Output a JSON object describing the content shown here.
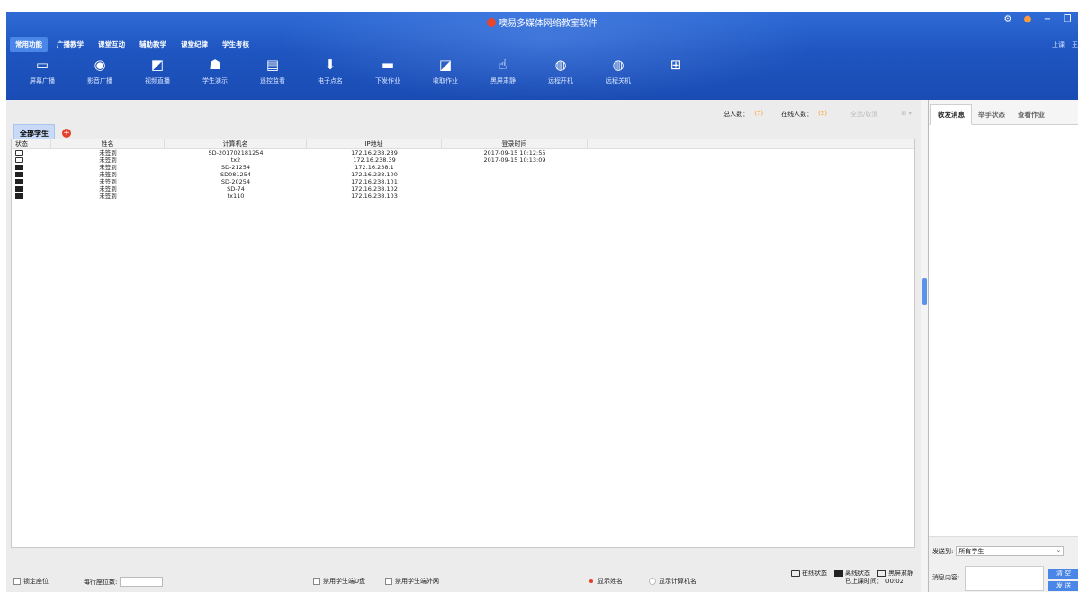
{
  "app": {
    "title": "噢易多媒体网络教室软件",
    "user_labels": [
      "上课",
      "王"
    ]
  },
  "window_controls": {
    "settings": "⚙",
    "alert": "●",
    "minimize": "−",
    "restore": "❐"
  },
  "tabs": [
    {
      "label": "常用功能",
      "active": true
    },
    {
      "label": "广播教学",
      "active": false
    },
    {
      "label": "课堂互动",
      "active": false
    },
    {
      "label": "辅助教学",
      "active": false
    },
    {
      "label": "课堂纪律",
      "active": false
    },
    {
      "label": "学生考核",
      "active": false
    }
  ],
  "toolbar": [
    {
      "label": "屏幕广播",
      "icon": "screen-broadcast-icon",
      "glyph": "▭"
    },
    {
      "label": "影音广播",
      "icon": "media-broadcast-icon",
      "glyph": "◉"
    },
    {
      "label": "视频直播",
      "icon": "video-live-icon",
      "glyph": "◩"
    },
    {
      "label": "学生演示",
      "icon": "student-demo-icon",
      "glyph": "☗"
    },
    {
      "label": "遥控监看",
      "icon": "remote-monitor-icon",
      "glyph": "▤"
    },
    {
      "label": "电子点名",
      "icon": "roll-call-icon",
      "glyph": "⬇"
    },
    {
      "label": "下发作业",
      "icon": "send-homework-icon",
      "glyph": "▬"
    },
    {
      "label": "收取作业",
      "icon": "collect-homework-icon",
      "glyph": "◪"
    },
    {
      "label": "黑屏肃静",
      "icon": "black-screen-icon",
      "glyph": "☝"
    },
    {
      "label": "远程开机",
      "icon": "remote-power-on-icon",
      "glyph": "◍"
    },
    {
      "label": "远程关机",
      "icon": "remote-power-off-icon",
      "glyph": "◍"
    },
    {
      "label": "",
      "icon": "add-tool-icon",
      "glyph": "⊞"
    }
  ],
  "stats": {
    "total_label": "总人数：",
    "total_value": "(7)",
    "online_label": "在线人数：",
    "online_value": "(2)",
    "select_all": "全选/取消",
    "view_icon": "grid-view-icon"
  },
  "group": {
    "tab_label": "全部学生"
  },
  "table": {
    "columns": [
      "状态",
      "姓名",
      "计算机名",
      "IP地址",
      "登录时间"
    ],
    "rows": [
      {
        "status": "online",
        "name": "未签到",
        "computer": "SD-201702181254",
        "ip": "172.16.238.239",
        "login": "2017-09-15 10:12:55"
      },
      {
        "status": "online",
        "name": "未签到",
        "computer": "tx2",
        "ip": "172.16.238.39",
        "login": "2017-09-15 10:13:09"
      },
      {
        "status": "offline",
        "name": "未签到",
        "computer": "SD-21254",
        "ip": "172.16.238.1",
        "login": ""
      },
      {
        "status": "offline",
        "name": "未签到",
        "computer": "SD081254",
        "ip": "172.16.238.100",
        "login": ""
      },
      {
        "status": "offline",
        "name": "未签到",
        "computer": "SD-20254",
        "ip": "172.16.238.101",
        "login": ""
      },
      {
        "status": "offline",
        "name": "未签到",
        "computer": "SD-74",
        "ip": "172.16.238.102",
        "login": ""
      },
      {
        "status": "offline",
        "name": "未签到",
        "computer": "tx110",
        "ip": "172.16.238.103",
        "login": ""
      }
    ]
  },
  "legend": {
    "online": "在线状态",
    "offline": "离线状态",
    "blackscreen": "黑屏肃静"
  },
  "bottom": {
    "lock_seat": "锁定座位",
    "seats_per_row": "每行座位数:",
    "ban_usb": "禁用学生端U盘",
    "ban_net": "禁用学生端外网",
    "show_name": "显示姓名",
    "show_computer": "显示计算机名",
    "class_time_label": "已上课时间：",
    "class_time_value": "00:02"
  },
  "right_panel": {
    "tabs": [
      {
        "label": "收发消息",
        "active": true
      },
      {
        "label": "举手状态",
        "active": false
      },
      {
        "label": "查看作业",
        "active": false
      }
    ],
    "send_to_label": "发送到:",
    "send_to_value": "所有学生",
    "message_label": "消息内容:",
    "clear_button": "清 空",
    "send_button": "发 送"
  },
  "colors": {
    "header": "#1f55c0",
    "accent": "#4a86e8",
    "warn": "#ff9e2a",
    "red": "#e3402b"
  }
}
